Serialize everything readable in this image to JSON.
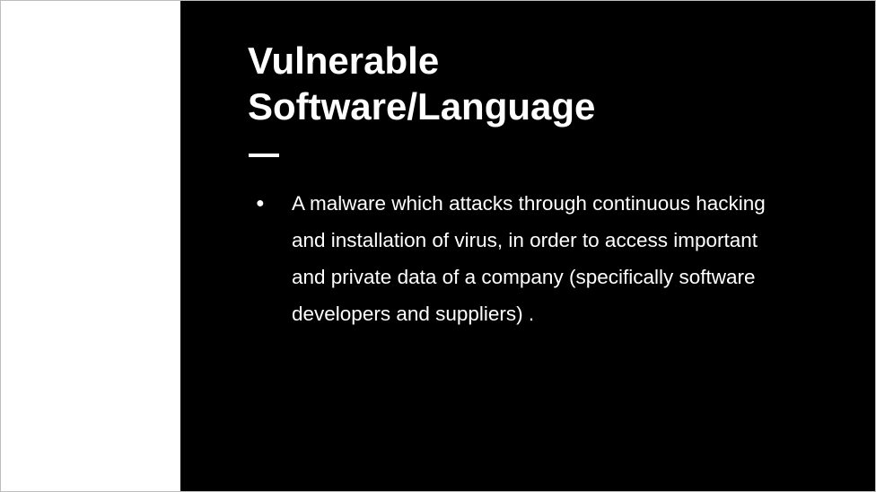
{
  "slide": {
    "title_line_1": "Vulnerable",
    "title_line_2": "Software/Language",
    "bullets": [
      {
        "mark": "●",
        "text": "A malware which attacks through continuous hacking and installation of virus, in order to access important and private data of a company (specifically software developers and suppliers) ."
      }
    ]
  },
  "colors": {
    "panel_background": "#000000",
    "left_background": "#ffffff",
    "text": "#ffffff"
  }
}
